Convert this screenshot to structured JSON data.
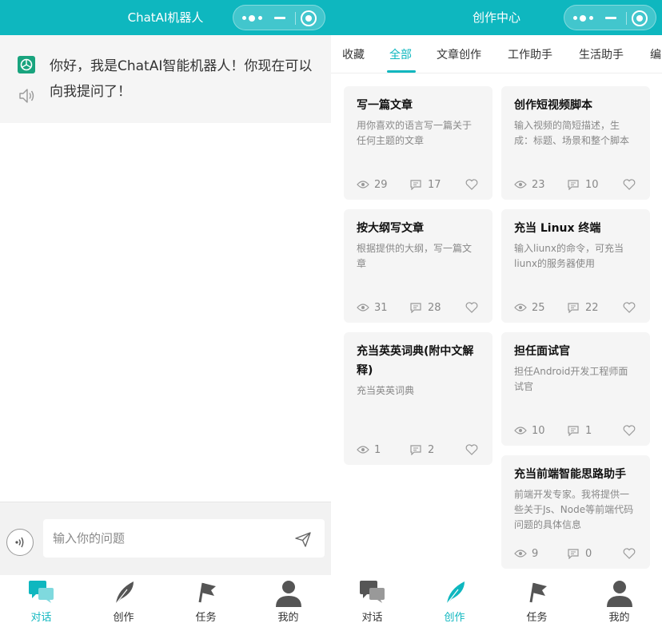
{
  "colors": {
    "accent": "#0eb7bf",
    "bot": "#19a47e"
  },
  "left": {
    "title": "ChatAI机器人",
    "message": "你好，我是ChatAI智能机器人！你现在可以向我提问了！",
    "input_placeholder": "输入你的问题"
  },
  "right": {
    "title": "创作中心",
    "categories": [
      "收藏",
      "全部",
      "文章创作",
      "工作助手",
      "生活助手",
      "编"
    ],
    "cards": [
      {
        "title": "写一篇文章",
        "desc": "用你喜欢的语言写一篇关于任何主题的文章",
        "views": "29",
        "comments": "17"
      },
      {
        "title": "创作短视频脚本",
        "desc": "输入视频的简短描述，生成：标题、场景和整个脚本",
        "views": "23",
        "comments": "10"
      },
      {
        "title": "按大纲写文章",
        "desc": "根据提供的大纲，写一篇文章",
        "views": "31",
        "comments": "28"
      },
      {
        "title": "充当 Linux 终端",
        "desc": "输入liunx的命令，可充当liunx的服务器使用",
        "views": "25",
        "comments": "22"
      },
      {
        "title": "充当英英词典(附中文解释)",
        "desc": "充当英英词典",
        "views": "1",
        "comments": "2"
      },
      {
        "title": "担任面试官",
        "desc": "担任Android开发工程师面试官",
        "views": "10",
        "comments": "1"
      },
      {
        "title": "充当前端智能思路助手",
        "desc": "前端开发专家。我将提供一些关于Js、Node等前端代码问题的具体信息",
        "views": "9",
        "comments": "0"
      }
    ]
  },
  "tabbar": {
    "items": [
      {
        "label": "对话",
        "icon": "chat-icon"
      },
      {
        "label": "创作",
        "icon": "feather-icon"
      },
      {
        "label": "任务",
        "icon": "flag-icon"
      },
      {
        "label": "我的",
        "icon": "user-icon"
      }
    ]
  }
}
